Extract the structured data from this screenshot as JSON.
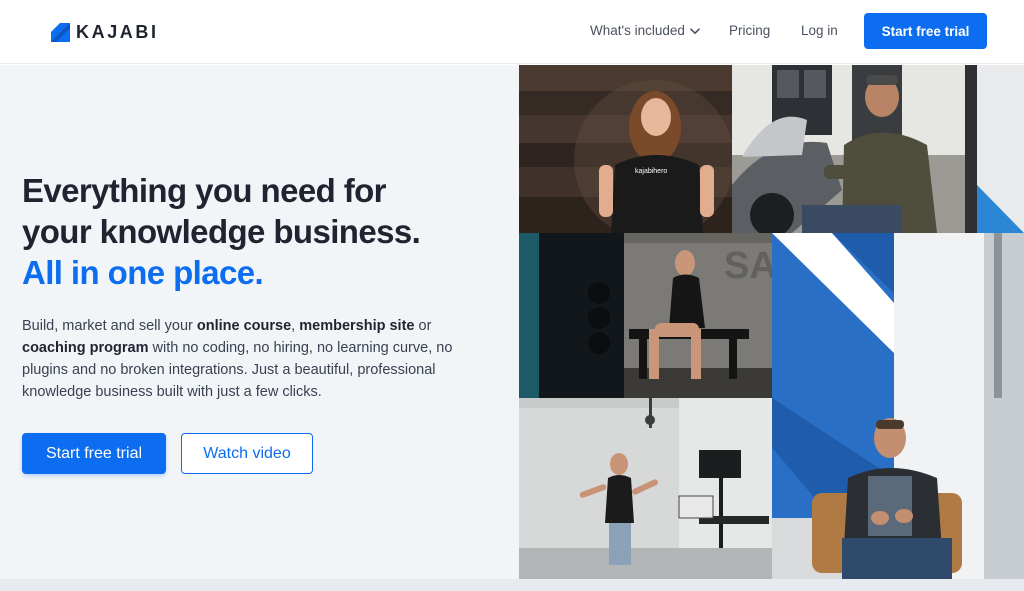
{
  "brand": {
    "name": "KAJABI",
    "accent_color": "#0d6df0"
  },
  "nav": {
    "items": [
      {
        "label": "What's included",
        "icon": "chevron-down-icon"
      },
      {
        "label": "Pricing"
      },
      {
        "label": "Log in"
      }
    ],
    "cta_label": "Start free trial"
  },
  "hero": {
    "headline_line1": "Everything you need for",
    "headline_line2": "your knowledge business.",
    "headline_line3": "All in one place.",
    "body": {
      "t1": "Build, market and sell your ",
      "b1": "online course",
      "t2": ", ",
      "b2": "membership site",
      "t3": " or ",
      "b3": "coaching program",
      "t4": " with no coding, no hiring, no learning curve, no plugins and no broken integrations. Just a beautiful, professional knowledge business built with just a few clicks."
    },
    "primary_cta": "Start free trial",
    "secondary_cta": "Watch video",
    "tshirt_text": "kajabihero"
  }
}
